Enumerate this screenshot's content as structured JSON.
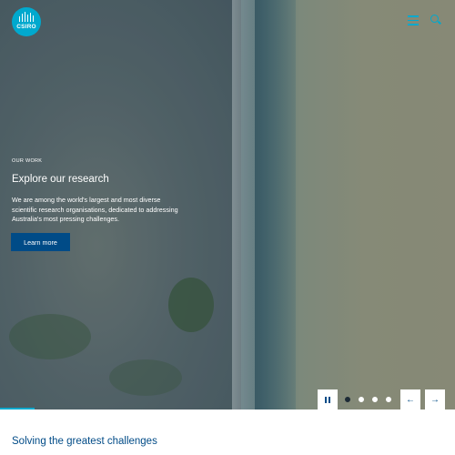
{
  "header": {
    "logo_text": "CSIRO",
    "menu_icon": "hamburger-menu-icon",
    "search_icon": "search-icon",
    "accent_color": "#00a9ce"
  },
  "hero": {
    "eyebrow": "OUR WORK",
    "title": "Explore our research",
    "description": "We are among the world's largest and most diverse scientific research organisations, dedicated to addressing Australia's most pressing challenges.",
    "button_label": "Learn more",
    "button_color": "#004b87"
  },
  "carousel": {
    "pause_icon": "pause-icon",
    "slides_count": 4,
    "active_slide": 1,
    "prev_icon": "arrow-left-icon",
    "next_icon": "arrow-right-icon"
  },
  "section": {
    "title": "Solving the greatest challenges"
  }
}
